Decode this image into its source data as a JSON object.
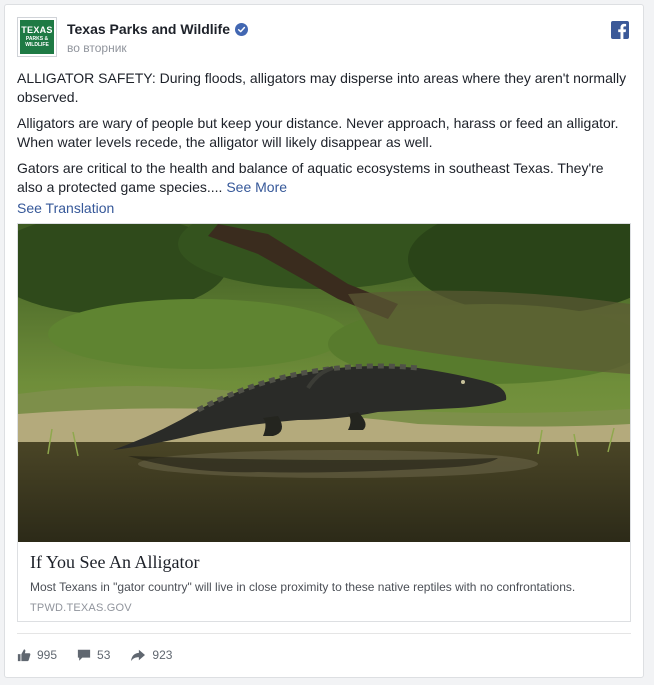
{
  "post": {
    "page_name": "Texas Parks and Wildlife",
    "timestamp": "во вторник",
    "logo": {
      "line1": "TEXAS",
      "line2": "PARKS &",
      "line3": "WILDLIFE"
    },
    "paragraphs": [
      "ALLIGATOR SAFETY: During floods, alligators may disperse into areas where they aren't normally observed.",
      "Alligators are wary of people but keep your distance. Never approach, harass or feed an alligator. When water levels recede, the alligator will likely disappear as well.",
      "Gators are critical to the health and balance of aquatic ecosystems in southeast Texas. They're also a protected game species...."
    ],
    "see_more": "See More",
    "see_translation": "See Translation"
  },
  "link": {
    "title": "If You See An Alligator",
    "description": "Most Texans in \"gator country\" will live in close proximity to these native reptiles with no confrontations.",
    "domain": "TPWD.TEXAS.GOV"
  },
  "stats": {
    "likes": "995",
    "comments": "53",
    "shares": "923"
  },
  "colors": {
    "link": "#365899",
    "verified": "#4267b2",
    "facebook": "#3b5998",
    "logo_green": "#1e7a44"
  },
  "icons": [
    "verified-badge-icon",
    "facebook-icon",
    "like-icon",
    "comment-icon",
    "share-icon"
  ]
}
